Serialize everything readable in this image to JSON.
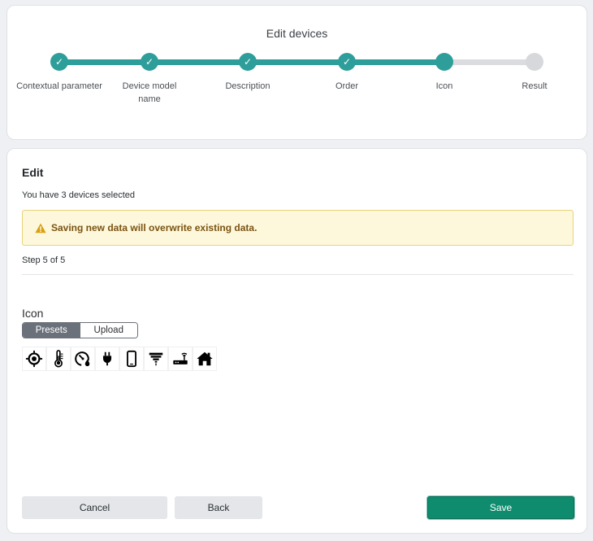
{
  "stepper": {
    "title": "Edit devices",
    "steps": [
      {
        "label": "Contextual parameter",
        "status": "done"
      },
      {
        "label": "Device model name",
        "status": "done"
      },
      {
        "label": "Description",
        "status": "done"
      },
      {
        "label": "Order",
        "status": "done"
      },
      {
        "label": "Icon",
        "status": "current"
      },
      {
        "label": "Result",
        "status": "pending"
      }
    ],
    "check_glyph": "✓"
  },
  "edit": {
    "heading": "Edit",
    "selection_text": "You have 3 devices selected",
    "warning": "Saving new data will overwrite existing data.",
    "step_text": "Step 5 of 5"
  },
  "icon_field": {
    "label": "Icon",
    "tabs": [
      {
        "label": "Presets",
        "active": true
      },
      {
        "label": "Upload",
        "active": false
      }
    ],
    "presets": [
      "crosshair-icon",
      "thermometer-icon",
      "gauge-drop-icon",
      "plug-icon",
      "smartphone-icon",
      "ceiling-lamp-icon",
      "router-icon",
      "home-icon"
    ]
  },
  "actions": {
    "cancel_label": "Cancel",
    "back_label": "Back",
    "save_label": "Save"
  },
  "colors": {
    "accent": "#2e9e9a",
    "save": "#0f8c6e",
    "warning_bg": "#fdf8dc",
    "warning_text": "#7a5312"
  }
}
